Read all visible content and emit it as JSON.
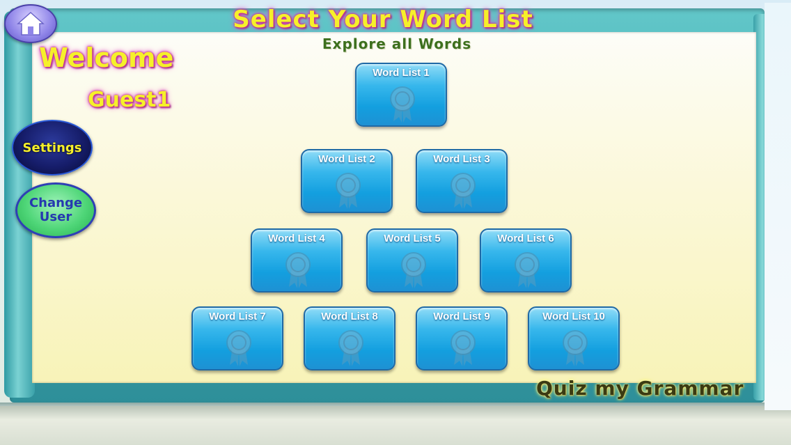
{
  "header": {
    "home_icon": "home-icon",
    "title": "Select Your Word List",
    "subtitle": "Explore all Words"
  },
  "user": {
    "welcome": "Welcome",
    "name": "Guest1"
  },
  "side_buttons": {
    "settings_label": "Settings",
    "change_user_label": "Change User"
  },
  "word_lists": [
    {
      "label": "Word List 1",
      "icon": "ribbon-badge-icon"
    },
    {
      "label": "Word List 2",
      "icon": "ribbon-badge-icon"
    },
    {
      "label": "Word List 3",
      "icon": "ribbon-badge-icon"
    },
    {
      "label": "Word List 4",
      "icon": "ribbon-badge-icon"
    },
    {
      "label": "Word List 5",
      "icon": "ribbon-badge-icon"
    },
    {
      "label": "Word List 6",
      "icon": "ribbon-badge-icon"
    },
    {
      "label": "Word List 7",
      "icon": "ribbon-badge-icon"
    },
    {
      "label": "Word List 8",
      "icon": "ribbon-badge-icon"
    },
    {
      "label": "Word List 9",
      "icon": "ribbon-badge-icon"
    },
    {
      "label": "Word List 10",
      "icon": "ribbon-badge-icon"
    }
  ],
  "footer": {
    "brand": "Quiz my Grammar"
  },
  "colors": {
    "tile_blue": "#139fdf",
    "title_yellow": "#f6f02a",
    "board_teal": "#3fa7ae"
  }
}
